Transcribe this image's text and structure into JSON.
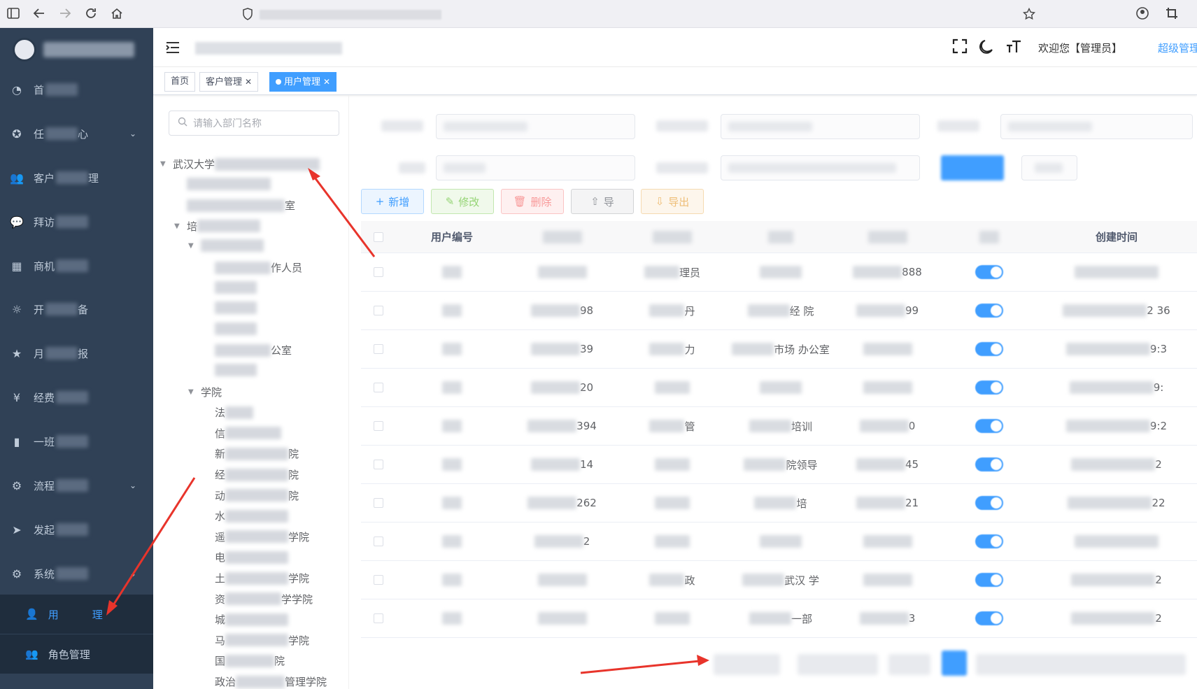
{
  "browser": {
    "icons": [
      "sidebar-toggle-icon",
      "back-icon",
      "forward-icon",
      "reload-icon",
      "home-icon",
      "shield-icon",
      "star-icon",
      "account-icon",
      "crop-icon"
    ]
  },
  "sidebar": {
    "items": [
      {
        "label_start": "首",
        "label_end": "",
        "icon": "dashboard-icon"
      },
      {
        "label_start": "任",
        "label_end": "心",
        "icon": "compass-icon",
        "has_arrow": true
      },
      {
        "label_start": "客户",
        "label_end": "理",
        "icon": "user-group-icon"
      },
      {
        "label_start": "拜访",
        "label_end": "",
        "icon": "wechat-icon"
      },
      {
        "label_start": "商机",
        "label_end": "",
        "icon": "table-icon"
      },
      {
        "label_start": "开",
        "label_end": "备",
        "icon": "sun-icon"
      },
      {
        "label_start": "月",
        "label_end": "报",
        "icon": "star-icon"
      },
      {
        "label_start": "经费",
        "label_end": "",
        "icon": "yen-icon"
      },
      {
        "label_start": "一班",
        "label_end": "",
        "icon": "bar-chart-icon"
      },
      {
        "label_start": "流程",
        "label_end": "",
        "icon": "gear-icon",
        "has_arrow": true
      },
      {
        "label_start": "发起",
        "label_end": "",
        "icon": "send-icon"
      },
      {
        "label_start": "系统",
        "label_end": "",
        "icon": "settings-icon",
        "has_arrow": true
      }
    ],
    "sub_items": [
      {
        "label": "用户管理",
        "label_visible_start": "用",
        "label_visible_end": "理",
        "active": true
      },
      {
        "label": "角色管理",
        "active": false
      }
    ]
  },
  "header": {
    "welcome": "欢迎您【管理员】",
    "admin_link": "超级管理"
  },
  "tags": [
    {
      "label": "首页",
      "closable": false,
      "active": false
    },
    {
      "label": "客户管理",
      "closable": true,
      "active": false
    },
    {
      "label": "用户管理",
      "closable": true,
      "active": true
    }
  ],
  "dept_tree": {
    "search_placeholder": "请输入部门名称",
    "nodes": [
      {
        "prefix": "武汉大学",
        "suffix": "",
        "level": 0,
        "expanded": true
      },
      {
        "prefix": "",
        "suffix": "",
        "level": 1
      },
      {
        "prefix": "",
        "suffix": "室",
        "level": 1
      },
      {
        "prefix": "培",
        "suffix": "",
        "level": 1,
        "expanded": true
      },
      {
        "prefix": "",
        "suffix": "",
        "level": 2,
        "expanded": true
      },
      {
        "prefix": "",
        "suffix": "作人员",
        "level": 3
      },
      {
        "prefix": "",
        "suffix": "",
        "level": 3
      },
      {
        "prefix": "",
        "suffix": "",
        "level": 3
      },
      {
        "prefix": "",
        "suffix": "",
        "level": 3
      },
      {
        "prefix": "",
        "suffix": "公室",
        "level": 3
      },
      {
        "prefix": "",
        "suffix": "",
        "level": 3
      },
      {
        "prefix": "学院",
        "suffix": "",
        "level": 2,
        "expanded": true
      },
      {
        "prefix": "法",
        "suffix": "",
        "level": 3
      },
      {
        "prefix": "信",
        "suffix": "",
        "level": 3
      },
      {
        "prefix": "新",
        "suffix": "院",
        "level": 3
      },
      {
        "prefix": "经",
        "suffix": "院",
        "level": 3
      },
      {
        "prefix": "动",
        "suffix": "院",
        "level": 3
      },
      {
        "prefix": "水",
        "suffix": "",
        "level": 3
      },
      {
        "prefix": "遥",
        "suffix": "学院",
        "level": 3
      },
      {
        "prefix": "电",
        "suffix": "",
        "level": 3
      },
      {
        "prefix": "土",
        "suffix": "学院",
        "level": 3
      },
      {
        "prefix": "资",
        "suffix": "学学院",
        "level": 3
      },
      {
        "prefix": "城",
        "suffix": "",
        "level": 3
      },
      {
        "prefix": "马",
        "suffix": "学院",
        "level": 3
      },
      {
        "prefix": "国",
        "suffix": "院",
        "level": 3
      },
      {
        "prefix": "政治",
        "suffix": "管理学院",
        "level": 3
      }
    ]
  },
  "toolbar": {
    "add": "新增",
    "edit": "修改",
    "delete": "删除",
    "import": "导",
    "export": "导出"
  },
  "table": {
    "headers": [
      "用户编号",
      "",
      "",
      "",
      "",
      "",
      "创建时间"
    ],
    "rows": [
      {
        "c2": "",
        "c3": "理员",
        "c4": "",
        "c5": "888",
        "status_on": true,
        "c7": ""
      },
      {
        "c2": "98",
        "c3": "丹",
        "c4": "经 院",
        "c5": "99",
        "status_on": false,
        "c7": "2 36"
      },
      {
        "c2": "39",
        "c3": "力",
        "c4": "市场 办公室",
        "c5": "",
        "status_on": false,
        "c7": "9:3"
      },
      {
        "c2": "20",
        "c3": "",
        "c4": "",
        "c5": "",
        "status_on": false,
        "c7": "9:"
      },
      {
        "c2": "394",
        "c3": "管",
        "c4": "培训",
        "c5": "0",
        "status_on": false,
        "c7": "9:2"
      },
      {
        "c2": "14",
        "c3": "",
        "c4": "院领导",
        "c5": "45",
        "status_on": true,
        "c7": "2"
      },
      {
        "c2": "262",
        "c3": "",
        "c4": "培",
        "c5": "21",
        "status_on": false,
        "c7": "22"
      },
      {
        "c2": "2",
        "c3": "",
        "c4": "",
        "c5": "",
        "status_on": true,
        "c7": ""
      },
      {
        "c2": "",
        "c3": "政",
        "c4": "武汉 学",
        "c5": "",
        "status_on": false,
        "c7": "2"
      },
      {
        "c2": "",
        "c3": "",
        "c4": "一部",
        "c5": "3",
        "status_on": true,
        "c7": "2"
      }
    ]
  },
  "colors": {
    "sidebar_bg": "#304156",
    "sidebar_sub_bg": "#1f2d3d",
    "primary": "#409eff",
    "annotation_arrow": "#e8342b"
  }
}
